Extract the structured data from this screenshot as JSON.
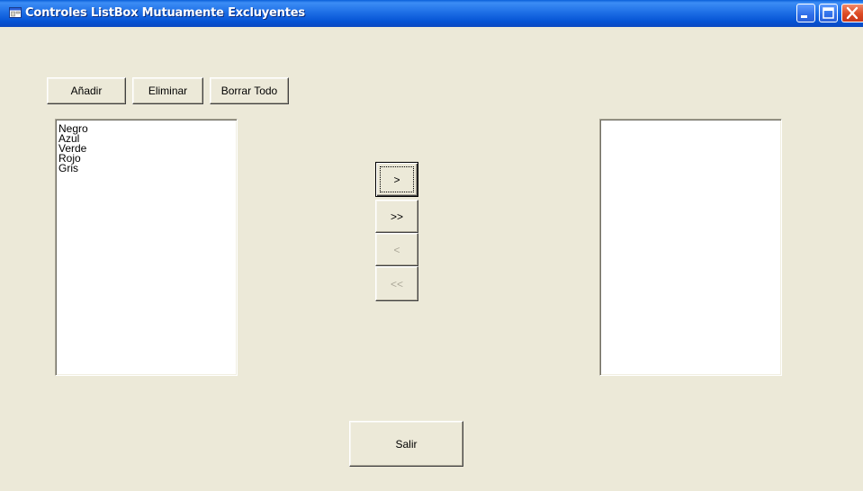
{
  "window": {
    "title": "Controles ListBox Mutuamente Excluyentes",
    "icon": "app-form-icon",
    "controls": {
      "minimize_icon": "minimize-icon",
      "maximize_icon": "maximize-icon",
      "close_icon": "close-icon"
    }
  },
  "toolbar": {
    "add_label": "Añadir",
    "remove_label": "Eliminar",
    "clear_all_label": "Borrar Todo"
  },
  "left_list": {
    "items": [
      "Negro",
      "Azul",
      "Verde",
      "Rojo",
      "Gris"
    ]
  },
  "right_list": {
    "items": []
  },
  "transfer": {
    "move_one_right": "  >  ",
    "move_all_right": ">>",
    "move_one_left": "<",
    "move_all_left": "<<"
  },
  "footer": {
    "exit_label": "Salir"
  },
  "colors": {
    "title_bar": "#1e6fe6",
    "window_bg": "#ece9d8",
    "close_button": "#dc4a22",
    "disabled_text": "#aca899"
  }
}
